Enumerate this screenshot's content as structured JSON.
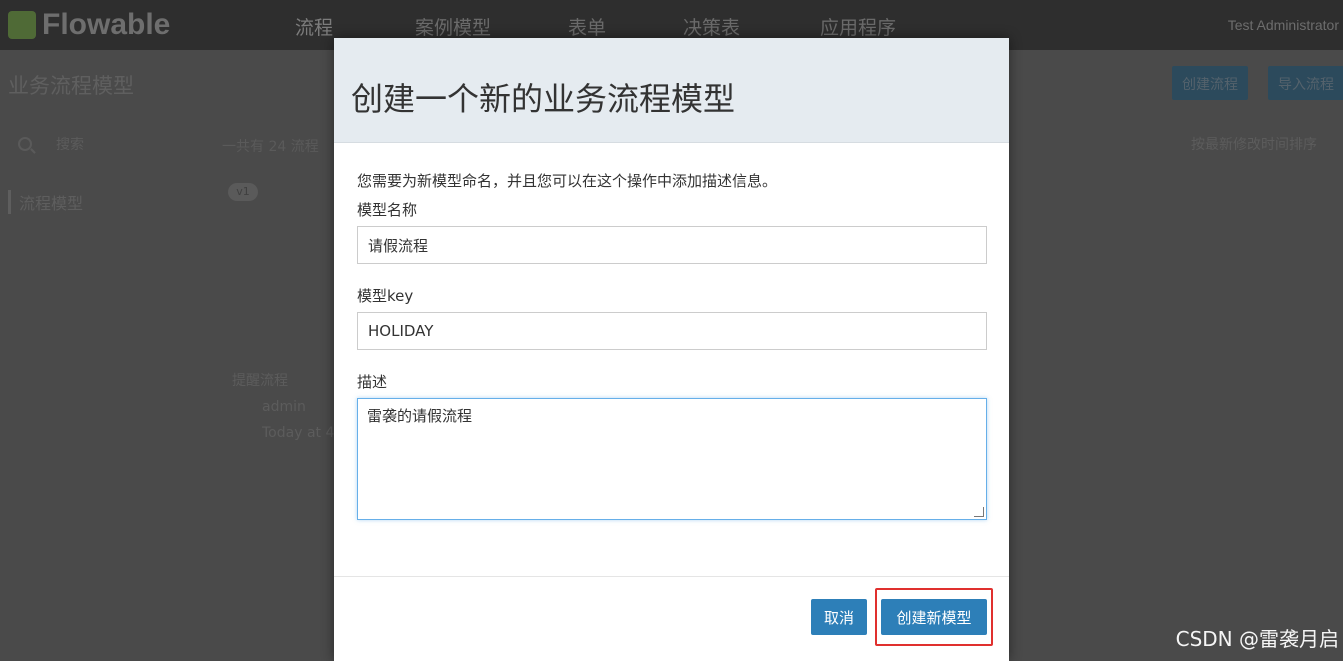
{
  "app": {
    "logo_text": "Flowable",
    "nav": [
      "流程",
      "案例模型",
      "表单",
      "决策表",
      "应用程序"
    ],
    "user": "Test Administrator",
    "page_title": "业务流程模型",
    "buttons": [
      "创建流程",
      "导入流程"
    ],
    "search_placeholder": "搜索",
    "sidebar_item": "流程模型",
    "count_text": "一共有 24 流程",
    "badge": "v1",
    "card_title": "提醒流程",
    "card_user": "admin",
    "card_time": "Today at 4",
    "sort_text": "按最新修改时间排序"
  },
  "modal": {
    "title": "创建一个新的业务流程模型",
    "description": "您需要为新模型命名，并且您可以在这个操作中添加描述信息。",
    "name_label": "模型名称",
    "name_value": "请假流程",
    "key_label": "模型key",
    "key_value": "HOLIDAY",
    "desc_label": "描述",
    "desc_value": "雷袭的请假流程",
    "cancel_label": "取消",
    "create_label": "创建新模型"
  },
  "watermark": "CSDN @雷袭月启",
  "colors": {
    "primary_button": "#2d7fb8",
    "highlight_frame": "#e0302e",
    "modal_header": "#e5ebf0"
  }
}
